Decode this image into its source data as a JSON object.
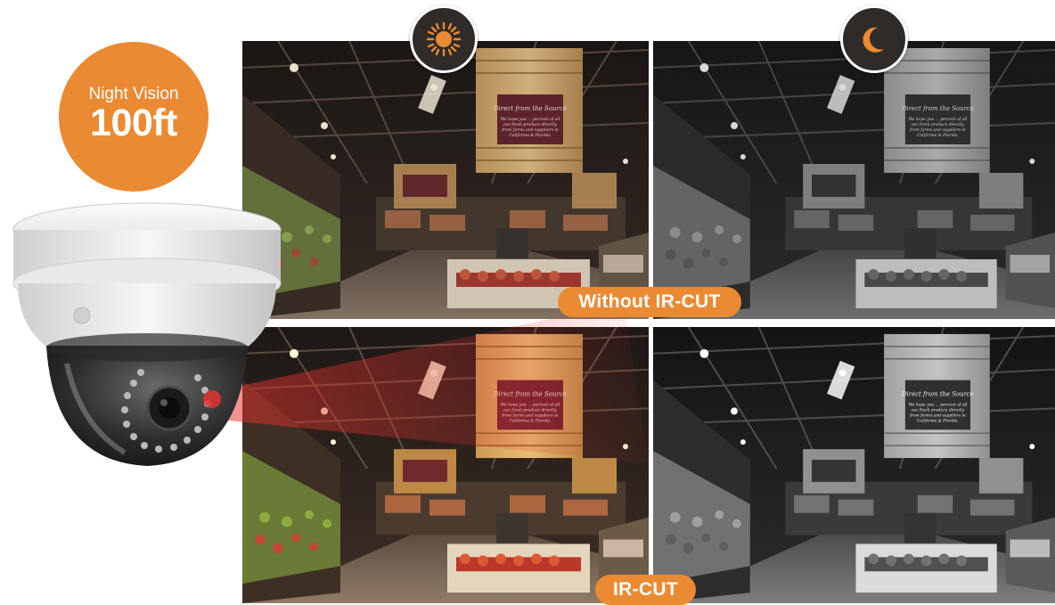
{
  "badge": {
    "line1": "Night Vision",
    "line2": "100ft"
  },
  "labels": {
    "without_ir_cut": "Without IR-CUT",
    "ir_cut": "IR-CUT"
  },
  "icons": {
    "day": "sun-icon",
    "night": "moon-icon"
  },
  "colors": {
    "accent_orange": "#ea8a32",
    "icon_badge_bg": "#2f2b29",
    "ir_beam": "#e1322d"
  },
  "store_sign": {
    "title": "Direct from the Source",
    "lines": [
      "We hope you ... percent of all",
      "our fresh produce directly",
      "from farms and suppliers in",
      "California & Florida."
    ]
  }
}
